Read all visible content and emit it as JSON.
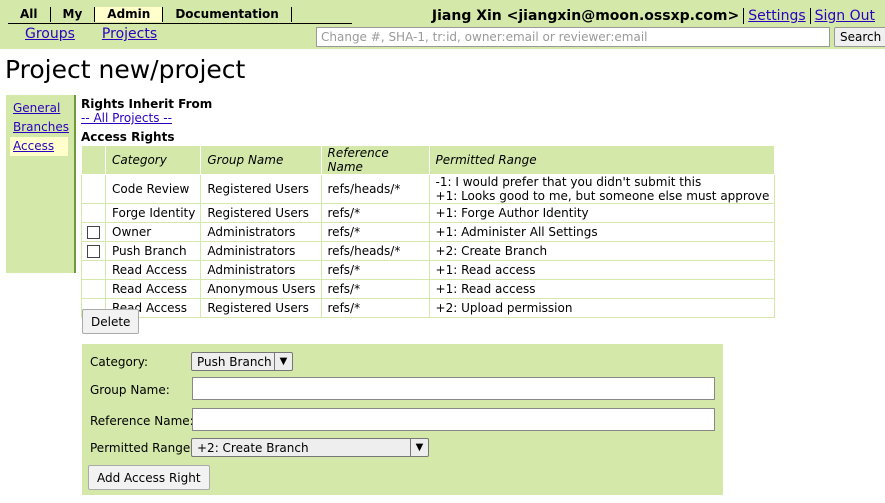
{
  "header": {
    "main_tabs": [
      "All",
      "My",
      "Admin",
      "Documentation"
    ],
    "active_tab": "Admin",
    "sub_tabs": [
      "Groups",
      "Projects"
    ],
    "user": "Jiang Xin <jiangxin@moon.ossxp.com>",
    "settings_link": "Settings",
    "signout_link": "Sign Out",
    "search_placeholder": "Change #, SHA-1, tr:id, owner:email or reviewer:email",
    "search_button": "Search",
    "accent_color": "#d4e9a9"
  },
  "page_title": "Project new/project",
  "sidebar": {
    "items": [
      "General",
      "Branches",
      "Access"
    ],
    "active": "Access"
  },
  "inherit": {
    "label": "Rights Inherit From",
    "link": "-- All Projects --"
  },
  "access": {
    "label": "Access Rights",
    "columns": [
      "Category",
      "Group Name",
      "Reference Name",
      "Permitted Range"
    ],
    "rows": [
      {
        "checkbox": false,
        "category": "Code Review",
        "group": "Registered Users",
        "ref": "refs/heads/*",
        "range": [
          "-1: I would prefer that you didn't submit this",
          "+1: Looks good to me, but someone else must approve"
        ]
      },
      {
        "checkbox": false,
        "category": "Forge Identity",
        "group": "Registered Users",
        "ref": "refs/*",
        "range": [
          "+1: Forge Author Identity"
        ]
      },
      {
        "checkbox": true,
        "category": "Owner",
        "group": "Administrators",
        "ref": "refs/*",
        "range": [
          "+1: Administer All Settings"
        ]
      },
      {
        "checkbox": true,
        "category": "Push Branch",
        "group": "Administrators",
        "ref": "refs/heads/*",
        "range": [
          "+2: Create Branch"
        ]
      },
      {
        "checkbox": false,
        "category": "Read Access",
        "group": "Administrators",
        "ref": "refs/*",
        "range": [
          "+1: Read access"
        ]
      },
      {
        "checkbox": false,
        "category": "Read Access",
        "group": "Anonymous Users",
        "ref": "refs/*",
        "range": [
          "+1: Read access"
        ]
      },
      {
        "checkbox": false,
        "category": "Read Access",
        "group": "Registered Users",
        "ref": "refs/*",
        "range": [
          "+2: Upload permission"
        ]
      }
    ],
    "delete_button": "Delete"
  },
  "add_form": {
    "category_label": "Category:",
    "category_value": "Push Branch",
    "group_label": "Group Name:",
    "group_value": "",
    "ref_label": "Reference Name:",
    "ref_value": "",
    "range_label": "Permitted Range:",
    "range_value": "+2: Create Branch",
    "add_button": "Add Access Right"
  }
}
